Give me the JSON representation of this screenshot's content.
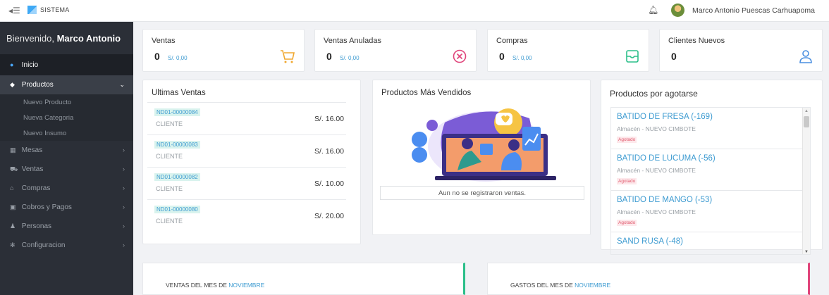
{
  "topbar": {
    "brand": "SISTEMA",
    "user_name": "Marco Antonio Puescas Carhuapoma"
  },
  "sidebar": {
    "welcome_prefix": "Bienvenido, ",
    "welcome_name": "Marco Antonio",
    "items": [
      {
        "label": "Inicio",
        "icon": "dashboard-icon"
      },
      {
        "label": "Productos",
        "icon": "box-icon"
      },
      {
        "label": "Mesas",
        "icon": "grid-icon"
      },
      {
        "label": "Ventas",
        "icon": "cart-icon"
      },
      {
        "label": "Compras",
        "icon": "store-icon"
      },
      {
        "label": "Cobros y Pagos",
        "icon": "money-icon"
      },
      {
        "label": "Personas",
        "icon": "user-icon"
      },
      {
        "label": "Configuracion",
        "icon": "gear-icon"
      }
    ],
    "productos_sub": [
      "Nuevo Producto",
      "Nueva Categoria",
      "Nuevo Insumo"
    ]
  },
  "stats": [
    {
      "label": "Ventas",
      "value": "0",
      "money": "S/. 0,00",
      "icon": "cart-icon",
      "color": "#f0a830"
    },
    {
      "label": "Ventas Anuladas",
      "value": "0",
      "money": "S/. 0,00",
      "icon": "close-circle-icon",
      "color": "#e0457b"
    },
    {
      "label": "Compras",
      "value": "0",
      "money": "S/. 0,00",
      "icon": "inbox-icon",
      "color": "#2bbf8a"
    },
    {
      "label": "Clientes Nuevos",
      "value": "0",
      "icon": "user-icon",
      "color": "#4a8fe0"
    }
  ],
  "ultimas_ventas": {
    "title": "Ultimas Ventas",
    "rows": [
      {
        "code": "ND01-00000084",
        "client": "CLIENTE",
        "amount": "S/. 16.00"
      },
      {
        "code": "ND01-00000083",
        "client": "CLIENTE",
        "amount": "S/. 16.00"
      },
      {
        "code": "ND01-00000082",
        "client": "CLIENTE",
        "amount": "S/. 10.00"
      },
      {
        "code": "ND01-00000080",
        "client": "CLIENTE",
        "amount": "S/. 20.00"
      }
    ]
  },
  "mas_vendidos": {
    "title": "Productos Más Vendidos",
    "empty_message": "Aun no se registraron ventas."
  },
  "agotarse": {
    "title": "Productos por agotarse",
    "items": [
      {
        "name": "BATIDO DE FRESA (-169)",
        "almacen": "Almacén - NUEVO CIMBOTE",
        "tag": "Agotado"
      },
      {
        "name": "BATIDO DE LUCUMA (-56)",
        "almacen": "Almacén - NUEVO CIMBOTE",
        "tag": "Agotado"
      },
      {
        "name": "BATIDO DE MANGO (-53)",
        "almacen": "Almacén - NUEVO CIMBOTE",
        "tag": "Agotado"
      },
      {
        "name": "SAND RUSA (-48)",
        "almacen": "",
        "tag": ""
      }
    ]
  },
  "ventas_mes": {
    "prefix": "VENTAS DEL MES DE ",
    "month": "NOVIEMBRE",
    "accent": "#2bbf8a"
  },
  "gastos_mes": {
    "prefix": "GASTOS DEL MES DE ",
    "month": "NOVIEMBRE",
    "accent": "#e0457b"
  }
}
